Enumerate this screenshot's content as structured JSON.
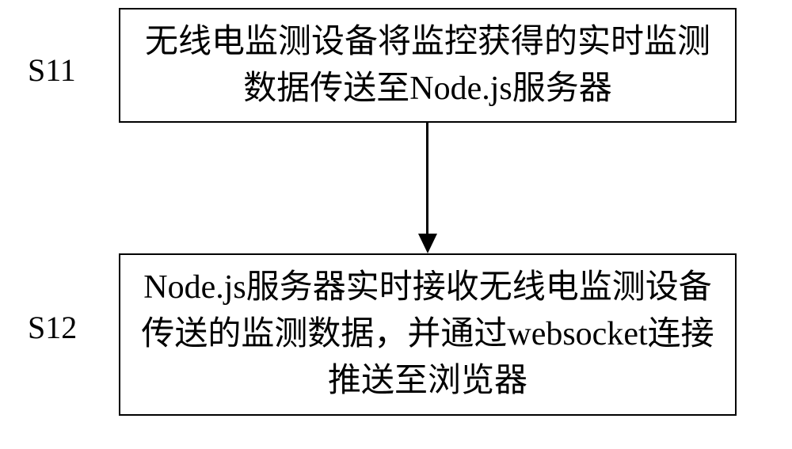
{
  "diagram": {
    "steps": [
      {
        "id": "S11",
        "label": "S11",
        "text": "无线电监测设备将监控获得的实时监测数据传送至Node.js服务器"
      },
      {
        "id": "S12",
        "label": "S12",
        "text": "Node.js服务器实时接收无线电监测设备传送的监测数据，并通过websocket连接推送至浏览器"
      }
    ]
  }
}
